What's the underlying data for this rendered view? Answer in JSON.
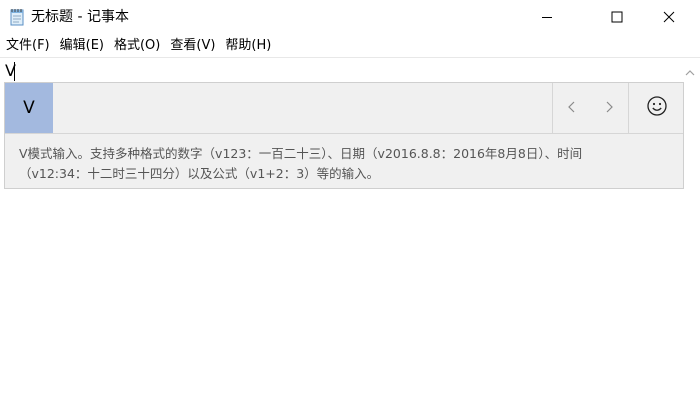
{
  "window": {
    "title": "无标题 - 记事本",
    "app_icon": "notepad-icon",
    "controls": {
      "minimize": "minimize-icon",
      "maximize": "maximize-icon",
      "close": "close-icon"
    }
  },
  "menubar": {
    "items": [
      {
        "label": "文件(F)"
      },
      {
        "label": "编辑(E)"
      },
      {
        "label": "格式(O)"
      },
      {
        "label": "查看(V)"
      },
      {
        "label": "帮助(H)"
      }
    ]
  },
  "editor": {
    "text": "V",
    "scroll_icon": "scroll-up-arrow-icon"
  },
  "ime": {
    "candidate": "V",
    "candidate_color": "#a3b9df",
    "prev_icon": "chevron-left-icon",
    "next_icon": "chevron-right-icon",
    "emoji_icon": "smiley-icon",
    "hint_line1": "V模式输入。支持多种格式的数字（v123：一百二十三）、日期（v2016.8.8：2016年8月8日）、时间",
    "hint_line2": "（v12:34：十二时三十四分）以及公式（v1+2：3）等的输入。"
  }
}
